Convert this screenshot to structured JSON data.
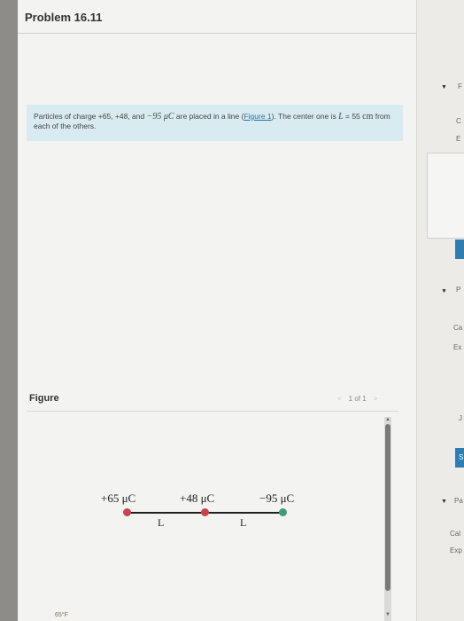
{
  "header": {
    "title": "Problem 16.11"
  },
  "problem": {
    "text_before": "Particles of charge +65, +48, and ",
    "charge_neg_math": "−95 μC",
    "text_mid": " are placed in a line (",
    "link_label": "Figure 1",
    "text_after": "). The center one is ",
    "L_math": "L",
    "eq_text": " = 55 ",
    "unit_math": "cm",
    "text_end": " from each of the others."
  },
  "figure": {
    "label": "Figure",
    "pager": {
      "prev": "<",
      "page_text": "1 of 1",
      "next": ">"
    },
    "charges": [
      {
        "label": "+65 μC",
        "color": "#c9424c"
      },
      {
        "label": "+48 μC",
        "color": "#c9424c"
      },
      {
        "label": "−95 μC",
        "color": "#3e9a78"
      }
    ],
    "distance_labels": [
      "L",
      "L"
    ]
  },
  "right_panel": {
    "items": [
      "F",
      "C",
      "E",
      "P",
      "Ca",
      "Ex",
      "J",
      "S",
      "Pa",
      "Cal",
      "Exp"
    ]
  },
  "temperature": "65°F"
}
